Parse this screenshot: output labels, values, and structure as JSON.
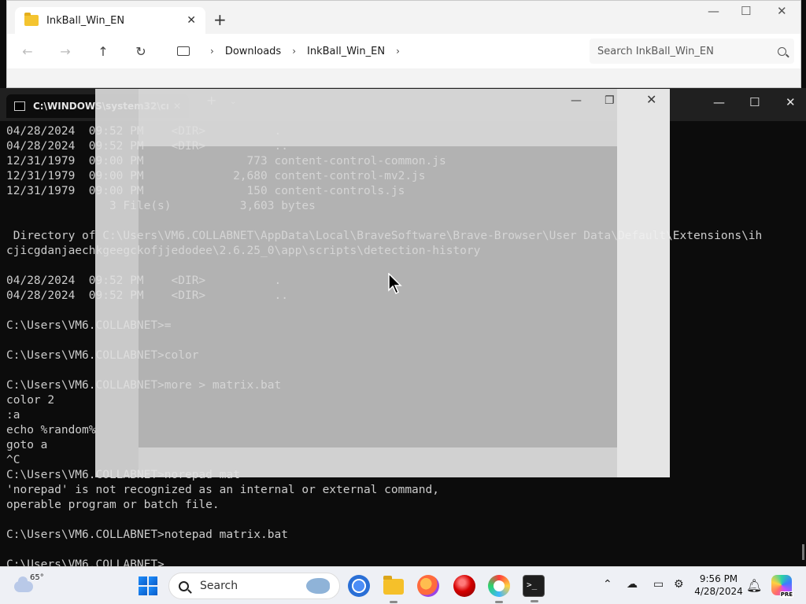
{
  "explorer": {
    "tab_title": "InkBall_Win_EN",
    "breadcrumbs": [
      "Downloads",
      "InkBall_Win_EN"
    ],
    "search_placeholder": "Search InkBall_Win_EN"
  },
  "terminal": {
    "tab_title": "C:\\WINDOWS\\system32\\cmd.",
    "lines": [
      "04/28/2024  09:52 PM    <DIR>          .",
      "04/28/2024  09:52 PM    <DIR>          ..",
      "12/31/1979  09:00 PM               773 content-control-common.js",
      "12/31/1979  09:00 PM             2,680 content-control-mv2.js",
      "12/31/1979  09:00 PM               150 content-controls.js",
      "               3 File(s)          3,603 bytes",
      "",
      " Directory of C:\\Users\\VM6.COLLABNET\\AppData\\Local\\BraveSoftware\\Brave-Browser\\User Data\\Default\\Extensions\\ih",
      "cjicgdanjaechkgeegckofjjedodee\\2.6.25_0\\app\\scripts\\detection-history",
      "",
      "04/28/2024  09:52 PM    <DIR>          .",
      "04/28/2024  09:52 PM    <DIR>          ..",
      "",
      "C:\\Users\\VM6.COLLABNET>=",
      "",
      "C:\\Users\\VM6.COLLABNET>color",
      "",
      "C:\\Users\\VM6.COLLABNET>more > matrix.bat",
      "color 2",
      ":a",
      "echo %random%",
      "goto a",
      "^C",
      "C:\\Users\\VM6.COLLABNET>norepad mat",
      "'norepad' is not recognized as an internal or external command,",
      "operable program or batch file.",
      "",
      "C:\\Users\\VM6.COLLABNET>notepad matrix.bat",
      "",
      "C:\\Users\\VM6.COLLABNET>"
    ]
  },
  "taskbar": {
    "temperature": "65°",
    "search_label": "Search",
    "time": "9:56 PM",
    "date": "4/28/2024",
    "copilot_badge": "PRE"
  }
}
